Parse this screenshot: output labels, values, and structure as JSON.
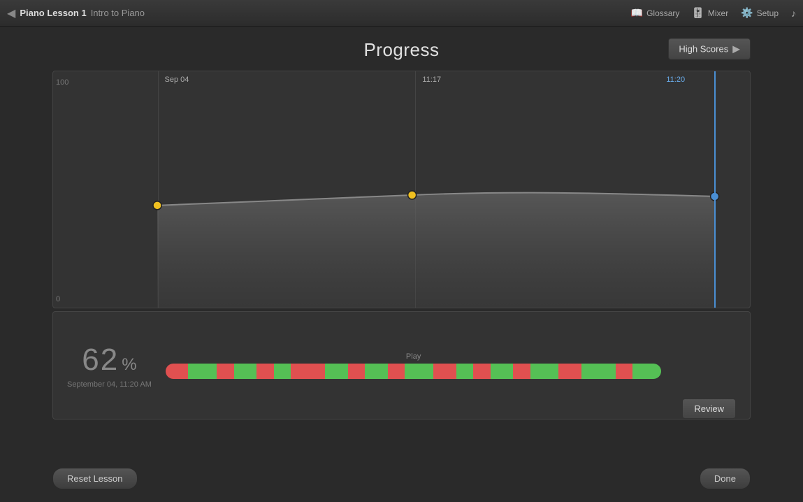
{
  "topbar": {
    "back_arrow": "◀",
    "lesson_title": "Piano Lesson 1",
    "lesson_subtitle": "Intro to Piano",
    "glossary_label": "Glossary",
    "mixer_label": "Mixer",
    "setup_label": "Setup",
    "music_icon": "♪"
  },
  "page": {
    "title": "Progress",
    "high_scores_label": "High Scores"
  },
  "chart": {
    "y_max": "100",
    "y_min": "0",
    "col1_label": "Sep 04",
    "col2_label": "11:17",
    "col3_label": "11:20",
    "col1_x_pct": 15,
    "col2_x_pct": 52,
    "col3_x_pct": 95
  },
  "bottom_panel": {
    "score": "62",
    "percent_sign": "%",
    "date": "September 04, 11:20 AM",
    "play_label": "Play",
    "review_label": "Review"
  },
  "footer": {
    "reset_label": "Reset Lesson",
    "done_label": "Done"
  },
  "playbar_segments": [
    {
      "color": "#e05050",
      "width": 4
    },
    {
      "color": "#55c055",
      "width": 5
    },
    {
      "color": "#e05050",
      "width": 3
    },
    {
      "color": "#55c055",
      "width": 4
    },
    {
      "color": "#e05050",
      "width": 3
    },
    {
      "color": "#55c055",
      "width": 3
    },
    {
      "color": "#e05050",
      "width": 6
    },
    {
      "color": "#55c055",
      "width": 4
    },
    {
      "color": "#e05050",
      "width": 3
    },
    {
      "color": "#55c055",
      "width": 4
    },
    {
      "color": "#e05050",
      "width": 3
    },
    {
      "color": "#55c055",
      "width": 5
    },
    {
      "color": "#e05050",
      "width": 4
    },
    {
      "color": "#55c055",
      "width": 3
    },
    {
      "color": "#e05050",
      "width": 3
    },
    {
      "color": "#55c055",
      "width": 4
    },
    {
      "color": "#e05050",
      "width": 3
    },
    {
      "color": "#55c055",
      "width": 5
    },
    {
      "color": "#e05050",
      "width": 4
    },
    {
      "color": "#55c055",
      "width": 6
    },
    {
      "color": "#e05050",
      "width": 3
    },
    {
      "color": "#55c055",
      "width": 5
    }
  ]
}
